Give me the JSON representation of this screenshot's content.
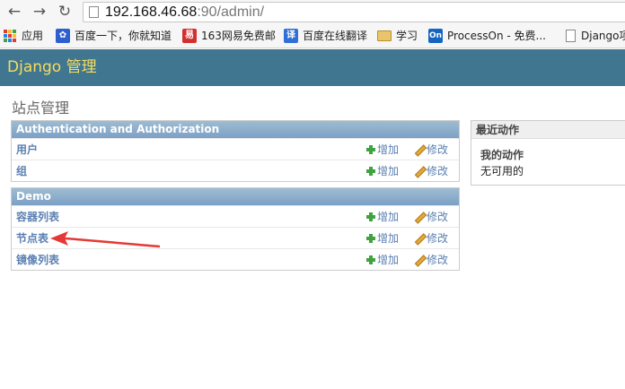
{
  "browser": {
    "url_host": "192.168.46.68",
    "url_rest": ":90/admin/"
  },
  "bookmarks": [
    {
      "label": "应用",
      "icon": "apps-grid-icon"
    },
    {
      "label": "百度一下，你就知道",
      "icon": "baidu-paw-icon"
    },
    {
      "label": "163网易免费邮",
      "icon": "netease-mail-icon"
    },
    {
      "label": "百度在线翻译",
      "icon": "translate-icon"
    },
    {
      "label": "学习",
      "icon": "folder-icon"
    },
    {
      "label": "ProcessOn - 免费...",
      "icon": "processon-icon"
    },
    {
      "label": "Django项",
      "icon": "page-icon"
    }
  ],
  "header": {
    "site_name": "Django 管理"
  },
  "page": {
    "title": "站点管理"
  },
  "modules": [
    {
      "caption": "Authentication and Authorization",
      "rows": [
        {
          "model": "用户",
          "add": "增加",
          "change": "修改"
        },
        {
          "model": "组",
          "add": "增加",
          "change": "修改"
        }
      ]
    },
    {
      "caption": "Demo",
      "rows": [
        {
          "model": "容器列表",
          "add": "增加",
          "change": "修改"
        },
        {
          "model": "节点表",
          "add": "增加",
          "change": "修改"
        },
        {
          "model": "镜像列表",
          "add": "增加",
          "change": "修改"
        }
      ]
    }
  ],
  "recent_actions": {
    "caption": "最近动作",
    "subtitle": "我的动作",
    "empty": "无可用的"
  },
  "colors": {
    "header_bg": "#417690",
    "site_name": "#f5dd5d",
    "link": "#5b80b2",
    "annotation_arrow": "#e53935"
  }
}
